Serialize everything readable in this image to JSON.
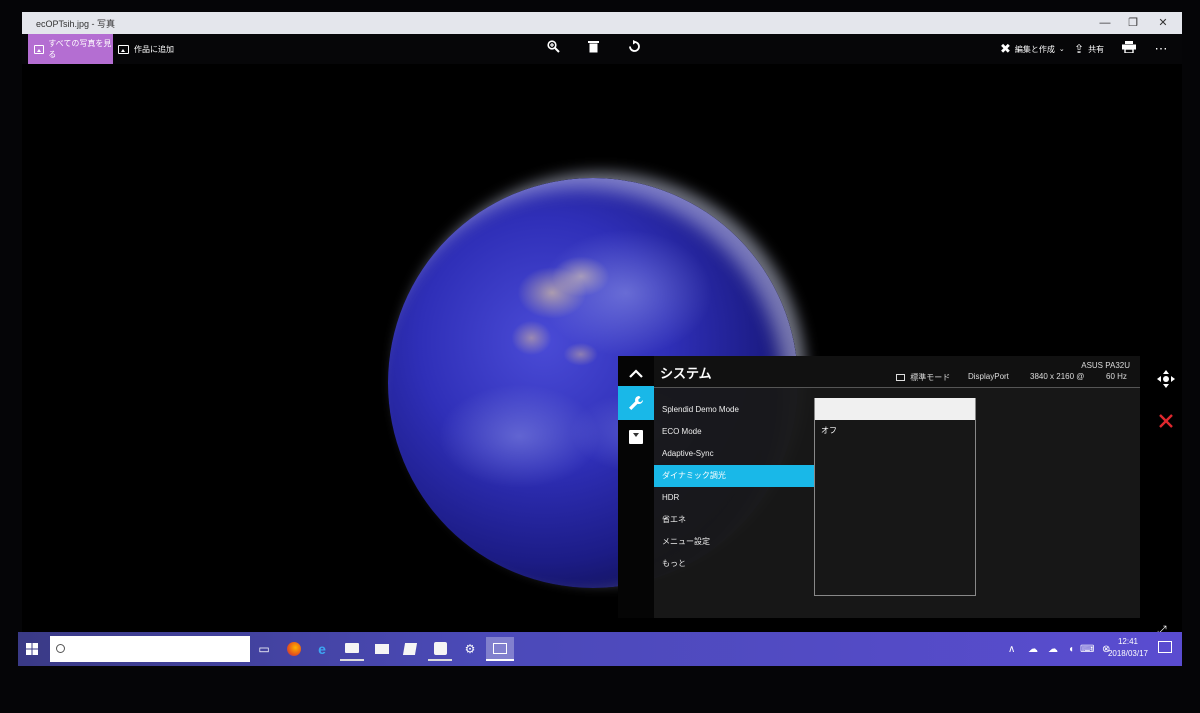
{
  "window": {
    "title": "ecOPTsih.jpg - 写真",
    "controls": {
      "minimize": "—",
      "maximize": "❐",
      "close": "✕"
    }
  },
  "toolbar": {
    "view_all_label": "すべての写真を見る",
    "add_to_creation_label": "作品に追加",
    "zoom_icon": "magnifier-plus",
    "delete_icon": "trash",
    "rotate_icon": "rotate",
    "edit_create_label": "編集と作成",
    "share_label": "共有",
    "print_icon": "printer",
    "more_icon": "ellipsis"
  },
  "osd": {
    "title": "システム",
    "mode_label": "標準モード",
    "input_label": "DisplayPort",
    "resolution_label": "3840 x 2160 @",
    "refresh_label": "60 Hz",
    "model_label": "ASUS PA32U",
    "accent_color": "#19b8e8",
    "menu_items": [
      {
        "label": "Splendid Demo Mode",
        "selected": false
      },
      {
        "label": "ECO Mode",
        "selected": false
      },
      {
        "label": "Adaptive-Sync",
        "selected": false
      },
      {
        "label": "ダイナミック調光",
        "selected": true
      },
      {
        "label": "HDR",
        "selected": false
      },
      {
        "label": "省エネ",
        "selected": false
      },
      {
        "label": "メニュー設定",
        "selected": false
      },
      {
        "label": "もっと",
        "selected": false
      }
    ],
    "sub_options": [
      "オフ"
    ]
  },
  "taskbar": {
    "clock_time": "12:41",
    "clock_date": "2018/03/17"
  }
}
